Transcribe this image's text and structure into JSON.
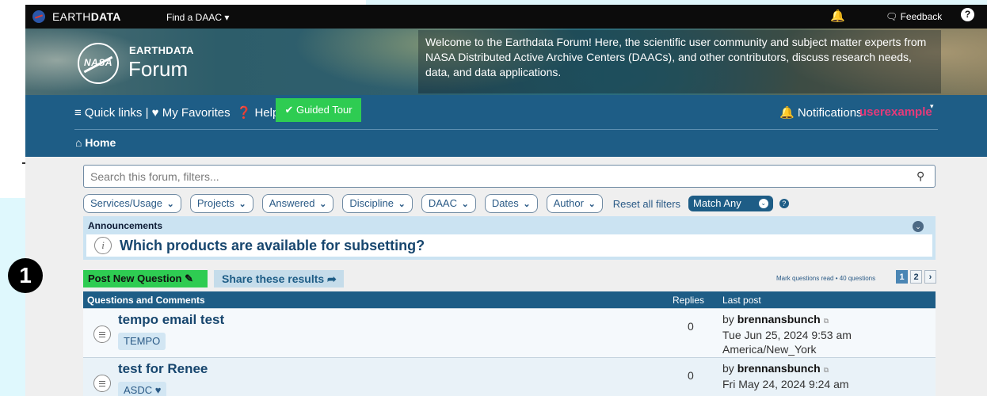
{
  "topbar": {
    "brand_light": "EARTH",
    "brand_bold": "DATA",
    "find_daac": "Find a DAAC",
    "find_caret": "▾",
    "bell": "🔔",
    "feedback": "Feedback",
    "help": "?"
  },
  "banner": {
    "logo_text": "NASA",
    "earthdata": "EARTHDATA",
    "forum": "Forum",
    "welcome": "Welcome to the Earthdata Forum! Here, the scientific user community and subject matter experts from NASA Distributed Active Archive Centers (DAACs), and other contributors, discuss research needs, data, and data applications."
  },
  "nav": {
    "quick_links": "≡ Quick links",
    "divider": " | ",
    "favorites": "♥ My Favorites",
    "help": "❓ Help",
    "tour": "✔ Guided Tour",
    "notifications": "🔔 Notifications",
    "username": "userexample",
    "username_caret": "▾",
    "home": "⌂ Home"
  },
  "search": {
    "placeholder": "Search this forum, filters...",
    "icon": "⚲"
  },
  "filters": {
    "buttons": [
      "Services/Usage",
      "Projects",
      "Answered",
      "Discipline",
      "DAAC",
      "Dates",
      "Author"
    ],
    "chevron": "⌄",
    "reset": "Reset all filters",
    "match": "Match Any",
    "match_caret": "⌄",
    "help": "?"
  },
  "announcements": {
    "heading": "Announcements",
    "toggle": "⌄",
    "icon": "i",
    "title": "Which products are available for subsetting?"
  },
  "step_marker": "1",
  "actions": {
    "post": "Post New Question ✎",
    "share": "Share these results ➦",
    "mark_read": "Mark questions read • 40 questions",
    "pages": [
      "1",
      "2",
      "›"
    ]
  },
  "list": {
    "header_main": "Questions and Comments",
    "header_replies": "Replies",
    "header_last": "Last post",
    "topics": [
      {
        "title": "tempo email test",
        "tag": "TEMPO",
        "replies": "0",
        "by": "by ",
        "author": "brennansbunch",
        "arrow": "⧉",
        "date": "Tue Jun 25, 2024 9:53 am",
        "tz": "America/New_York"
      },
      {
        "title": "test for Renee",
        "tag": "ASDC ♥",
        "replies": "0",
        "by": "by ",
        "author": "brennansbunch",
        "arrow": "⧉",
        "date": "Fri May 24, 2024 9:24 am",
        "tz": ""
      }
    ]
  },
  "colors": {
    "nav_blue": "#1e5d86",
    "tour_green": "#2ecc52",
    "username_pink": "#e63a7a",
    "announce_blue": "#cbe3f2"
  }
}
